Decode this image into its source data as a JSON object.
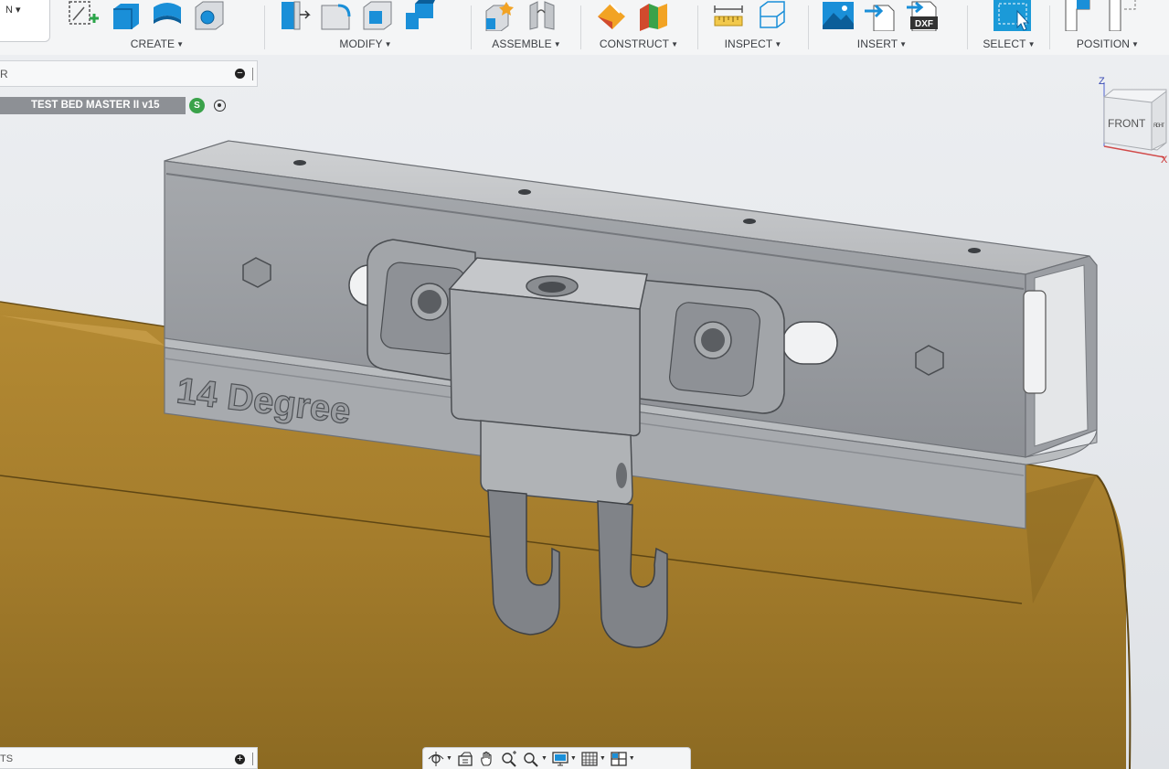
{
  "ribbon": {
    "workspace_caret": "N ▾",
    "groups": [
      {
        "label": "CREATE",
        "icons": [
          "sketch-icon",
          "extrude-icon",
          "revolve-icon",
          "hole-icon"
        ]
      },
      {
        "label": "MODIFY",
        "icons": [
          "press-pull-icon",
          "fillet-icon",
          "shell-icon",
          "combine-icon"
        ]
      },
      {
        "label": "ASSEMBLE",
        "icons": [
          "new-component-icon",
          "joint-icon"
        ]
      },
      {
        "label": "CONSTRUCT",
        "icons": [
          "offset-plane-icon",
          "midplane-icon"
        ]
      },
      {
        "label": "INSPECT",
        "icons": [
          "measure-icon",
          "section-analysis-icon"
        ]
      },
      {
        "label": "INSERT",
        "icons": [
          "insert-canvas-icon",
          "insert-derive-icon",
          "insert-dxf-icon"
        ]
      },
      {
        "label": "SELECT",
        "icons": [
          "select-icon"
        ]
      },
      {
        "label": "POSITION",
        "icons": [
          "capture-position-icon",
          "revert-position-icon"
        ]
      }
    ],
    "caret": "▼",
    "dxf_text": "DXF"
  },
  "browser": {
    "title": "R",
    "document_name": "TEST BED MASTER II v15",
    "badge": "S"
  },
  "viewport": {
    "embossed_text": "14 Degree",
    "viewcube": {
      "face": "FRONT",
      "right_face": "RIGHT",
      "axis_z": "Z",
      "axis_x": "X"
    }
  },
  "comments": {
    "title": "TS"
  },
  "navbar": {
    "items": [
      "orbit-icon",
      "look-at-icon",
      "pan-icon",
      "zoom-icon",
      "fit-icon",
      "display-settings-icon",
      "grid-icon",
      "viewports-icon"
    ]
  },
  "colors": {
    "accent_blue": "#0e8fd8",
    "select_blue": "#1b9ad8",
    "metal": "#9c9fa4",
    "board_wood": "#a9822f",
    "badge_green": "#3aa24a"
  }
}
